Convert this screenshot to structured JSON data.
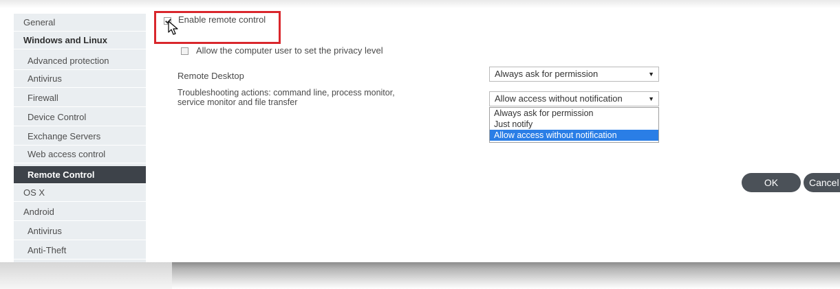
{
  "sidebar": {
    "items": [
      {
        "label": "General"
      },
      {
        "label": "Windows and Linux"
      },
      {
        "label": "Advanced protection"
      },
      {
        "label": "Antivirus"
      },
      {
        "label": "Firewall"
      },
      {
        "label": "Device Control"
      },
      {
        "label": "Exchange Servers"
      },
      {
        "label": "Web access control"
      },
      {
        "label": "Remote Control"
      },
      {
        "label": "OS X"
      },
      {
        "label": "Android"
      },
      {
        "label": "Antivirus"
      },
      {
        "label": "Anti-Theft"
      }
    ]
  },
  "settings": {
    "enable_remote_control": {
      "label": "Enable remote control",
      "checked": true
    },
    "allow_privacy": {
      "label": "Allow the computer user to set the privacy level",
      "checked": false
    },
    "remote_desktop": {
      "label": "Remote Desktop",
      "value": "Always ask for permission"
    },
    "troubleshooting": {
      "label_line1": "Troubleshooting actions: command line, process monitor,",
      "label_line2": "service monitor and file transfer",
      "value": "Allow access without notification",
      "options": [
        "Always ask for permission",
        "Just notify",
        "Allow access without notification"
      ]
    }
  },
  "buttons": {
    "ok": "OK",
    "cancel": "Cancel"
  },
  "colors": {
    "active_item": "#3d4249",
    "highlight": "#d9262c",
    "option_selected": "#2a7ee6"
  },
  "icons": {
    "cursor": "mouse-pointer-icon",
    "dropdown": "dropdown-arrow-icon"
  }
}
